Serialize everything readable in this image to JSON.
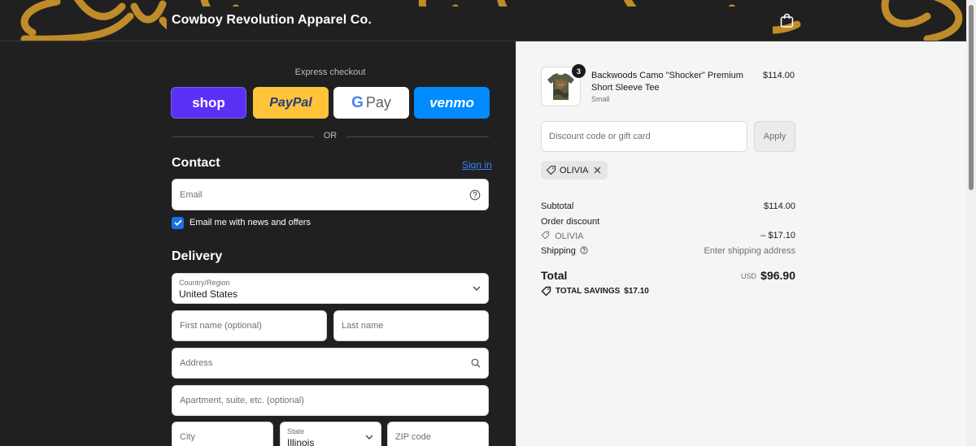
{
  "header": {
    "store_name": "Cowboy Revolution Apparel Co."
  },
  "express_checkout": {
    "title": "Express checkout",
    "buttons": {
      "shop": "shop",
      "paypal": "PayPal",
      "gpay_g": "G",
      "gpay": "Pay",
      "venmo": "venmo"
    },
    "or_label": "OR"
  },
  "contact": {
    "title": "Contact",
    "sign_in": "Sign in",
    "email_placeholder": "Email",
    "newsletter_label": "Email me with news and offers",
    "newsletter_checked": true
  },
  "delivery": {
    "title": "Delivery",
    "country_label": "Country/Region",
    "country_value": "United States",
    "first_name_placeholder": "First name (optional)",
    "last_name_placeholder": "Last name",
    "address_placeholder": "Address",
    "apartment_placeholder": "Apartment, suite, etc. (optional)",
    "city_placeholder": "City",
    "state_label": "State",
    "state_value": "Illinois",
    "zip_placeholder": "ZIP code"
  },
  "order": {
    "item": {
      "name": "Backwoods Camo \"Shocker\" Premium Short Sleeve Tee",
      "variant": "Small",
      "quantity": "3",
      "price": "$114.00"
    },
    "discount_placeholder": "Discount code or gift card",
    "apply_label": "Apply",
    "applied_code": "OLIVIA",
    "subtotal_label": "Subtotal",
    "subtotal_value": "$114.00",
    "order_discount_label": "Order discount",
    "discount_code": "OLIVIA",
    "discount_value": "– $17.10",
    "shipping_label": "Shipping",
    "shipping_value": "Enter shipping address",
    "total_label": "Total",
    "total_currency": "USD",
    "total_value": "$96.90",
    "savings_label": "TOTAL SAVINGS",
    "savings_value": "$17.10"
  },
  "colors": {
    "shop": "#5a31f4",
    "paypal": "#ffc439",
    "venmo": "#008cff",
    "checkbox": "#1773e6",
    "link": "#3b82f6",
    "banner_script": "#d19a2a"
  },
  "icons": [
    "shopping-bag-icon",
    "help-circle-icon",
    "checkmark-icon",
    "chevron-down-icon",
    "search-icon",
    "tag-icon",
    "close-icon"
  ]
}
